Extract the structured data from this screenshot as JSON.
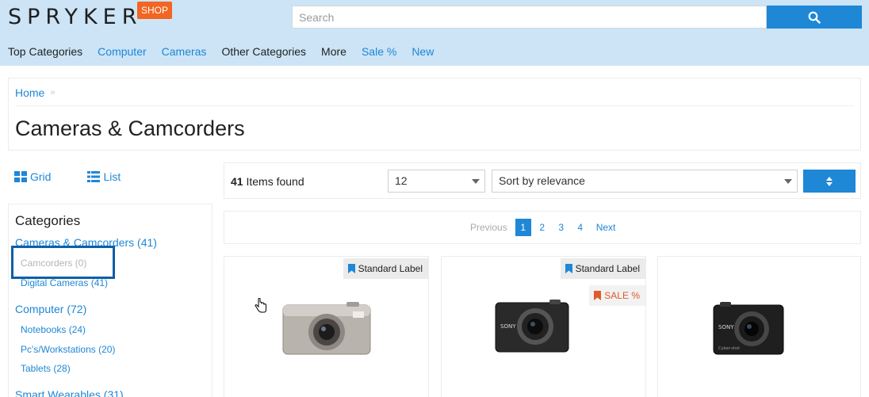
{
  "header": {
    "logo_text": "SPRYKER",
    "shop_badge": "SHOP",
    "search_placeholder": "Search",
    "search_icon": "search-icon",
    "nav": [
      {
        "label": "Top Categories",
        "style": "dark"
      },
      {
        "label": "Computer",
        "style": "blue"
      },
      {
        "label": "Cameras",
        "style": "blue"
      },
      {
        "label": "Other Categories",
        "style": "dark"
      },
      {
        "label": "More",
        "style": "dark"
      },
      {
        "label": "Sale %",
        "style": "blue"
      },
      {
        "label": "New",
        "style": "blue"
      }
    ]
  },
  "breadcrumb": {
    "home": "Home",
    "separator_icon": "double-chevron-right-icon"
  },
  "page_title": "Cameras & Camcorders",
  "view_toggle": {
    "grid": "Grid",
    "list": "List"
  },
  "sidebar": {
    "title": "Categories",
    "items": [
      {
        "label": "Cameras & Camcorders (41)",
        "level": 1
      },
      {
        "label": "Camcorders (0)",
        "level": 2,
        "muted": true
      },
      {
        "label": "Digital Cameras (41)",
        "level": 2
      },
      {
        "label": "Computer (72)",
        "level": 1
      },
      {
        "label": "Notebooks (24)",
        "level": 2
      },
      {
        "label": "Pc's/Workstations (20)",
        "level": 2
      },
      {
        "label": "Tablets (28)",
        "level": 2
      },
      {
        "label": "Smart Wearables (31)",
        "level": 1
      }
    ]
  },
  "toolbar": {
    "items_count": "41",
    "items_text": "Items found",
    "per_page": "12",
    "sort": "Sort by relevance",
    "sort_direction_icon": "sort-icon"
  },
  "pagination": {
    "previous": "Previous",
    "pages": [
      "1",
      "2",
      "3",
      "4"
    ],
    "active_page": "1",
    "next": "Next"
  },
  "products": [
    {
      "labels": [
        "Standard Label"
      ],
      "image": "silver-compact-camera"
    },
    {
      "labels": [
        "Standard Label",
        "SALE %"
      ],
      "image": "black-sony-compact-camera",
      "sale_color": "#e05a2b"
    },
    {
      "labels": [],
      "image": "black-sony-cybershot-camera"
    }
  ],
  "colors": {
    "header_bg": "#cce4f6",
    "accent": "#1e87d6",
    "shop_badge": "#f26522",
    "highlight_box": "#0d5fa6"
  }
}
